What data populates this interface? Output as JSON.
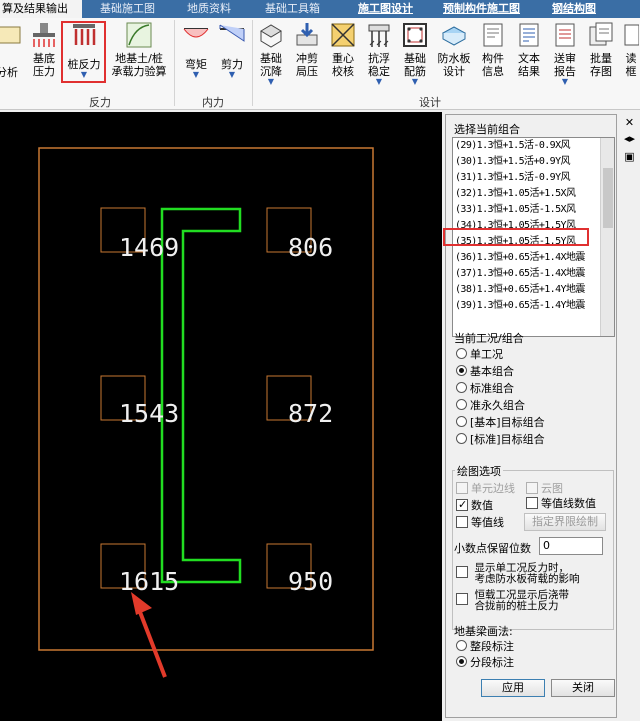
{
  "tabs": [
    {
      "label": "算及结果输出",
      "active": true
    },
    {
      "label": "基础施工图"
    },
    {
      "label": "地质资料"
    },
    {
      "label": "基础工具箱"
    },
    {
      "label": "施工图设计",
      "blue": true
    },
    {
      "label": "预制构件施工图",
      "blue": true
    },
    {
      "label": "钢结构图",
      "blue": true
    }
  ],
  "ribbon": {
    "buttons": {
      "analysis": "分析",
      "base_pressure_1": "基底",
      "base_pressure_2": "压力",
      "pile_reaction": "桩反力",
      "foundation_1": "地基土/桩",
      "foundation_2": "承载力验算",
      "moment": "弯矩",
      "shear": "剪力",
      "settlement_1": "基础",
      "settlement_2": "沉降",
      "punching_1": "冲剪",
      "punching_2": "局压",
      "gravity_1": "重心",
      "gravity_2": "校核",
      "float_1": "抗浮",
      "float_2": "稳定",
      "rebar_1": "基础",
      "rebar_2": "配筋",
      "waterproof_1": "防水板",
      "waterproof_2": "设计",
      "member_1": "构件",
      "member_2": "信息",
      "text_1": "文本",
      "text_2": "结果",
      "review_1": "送审",
      "review_2": "报告",
      "batch_1": "批量",
      "batch_2": "存图",
      "more_1": "读",
      "more_2": "框"
    },
    "groups": {
      "reaction": "反力",
      "internal": "内力",
      "design": "设计"
    }
  },
  "canvas": {
    "pile_values": [
      "1469",
      "806",
      "1543",
      "872",
      "1615",
      "950"
    ]
  },
  "panel": {
    "combo_title": "选择当前组合",
    "combos": [
      "(29)1.3恒+1.5活-0.9X风",
      "(30)1.3恒+1.5活+0.9Y风",
      "(31)1.3恒+1.5活-0.9Y风",
      "(32)1.3恒+1.05活+1.5X风",
      "(33)1.3恒+1.05活-1.5X风",
      "(34)1.3恒+1.05活+1.5Y风",
      "(35)1.3恒+1.05活-1.5Y风",
      "(36)1.3恒+0.65活+1.4X地震",
      "(37)1.3恒+0.65活-1.4X地震",
      "(38)1.3恒+0.65活+1.4Y地震",
      "(39)1.3恒+0.65活-1.4Y地震"
    ],
    "case_title": "当前工况/组合",
    "case_options": [
      "单工况",
      "基本组合",
      "标准组合",
      "准永久组合",
      "[基本]目标组合",
      "[标准]目标组合"
    ],
    "case_selected": "基本组合",
    "draw_title": "绘图选项",
    "opt_element_edge": "单元边线",
    "opt_cloud": "云图",
    "opt_value": "数值",
    "opt_contour_value": "等值线数值",
    "opt_contour": "等值线",
    "btn_boundary": "指定界限绘制",
    "decimal_label": "小数点保留位数",
    "decimal_value": "0",
    "single_case_1": "显示单工况反力时，",
    "single_case_2": "考虑防水板荷载的影响",
    "dead_load_1": "恒载工况显示后浇带",
    "dead_load_2": "合拢前的桩土反力",
    "beam_title": "地基梁画法:",
    "beam_options": [
      "整段标注",
      "分段标注"
    ],
    "beam_selected": "分段标注",
    "apply": "应用",
    "close": "关闭"
  },
  "colors": {
    "canvas_bg": "#000000",
    "outline": "#c87832",
    "wall": "#22dd22",
    "highlight": "#e03030"
  }
}
